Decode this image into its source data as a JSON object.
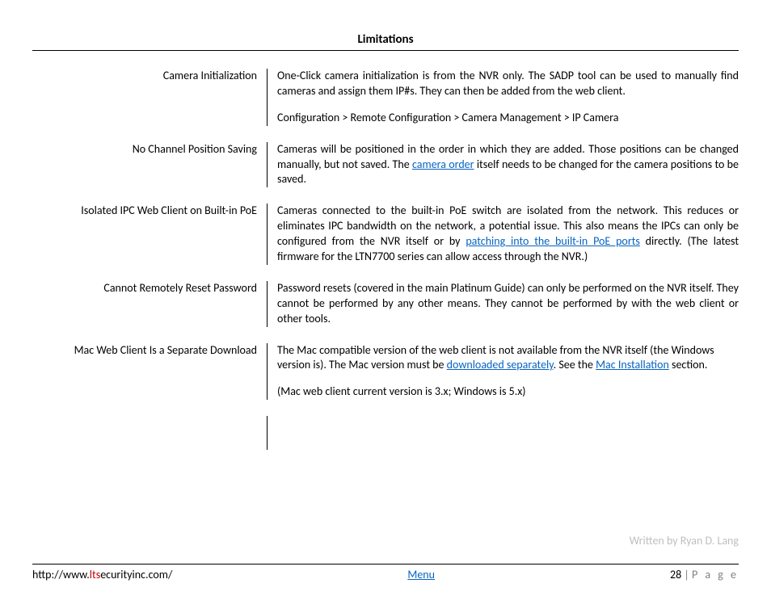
{
  "heading": "Limitations",
  "rows": [
    {
      "label": "Camera Initialization",
      "paragraphs": [
        {
          "justify": true,
          "segments": [
            {
              "t": "One-Click camera initialization is from the NVR only.  The SADP tool can be used to manually find cameras and assign them IP#s.  They can then be added from the web client."
            }
          ]
        },
        {
          "justify": false,
          "segments": [
            {
              "t": "Configuration > Remote Configuration > Camera Management > IP Camera"
            }
          ]
        }
      ]
    },
    {
      "label": "No Channel Position Saving",
      "paragraphs": [
        {
          "justify": true,
          "segments": [
            {
              "t": "Cameras will be positioned in the order in which they are added.  Those positions can be changed manually, but not saved.  The "
            },
            {
              "t": "camera order",
              "link": true
            },
            {
              "t": " itself needs to be changed for the camera positions to be saved."
            }
          ]
        }
      ]
    },
    {
      "label": "Isolated IPC Web Client on Built-in PoE",
      "paragraphs": [
        {
          "justify": true,
          "segments": [
            {
              "t": "Cameras connected to the built-in PoE switch are isolated from the network.  This reduces or eliminates IPC bandwidth on the network, a potential issue.  This also means the IPCs can only be configured from the NVR itself or by "
            },
            {
              "t": "patching into the built-in PoE ports",
              "link": true
            },
            {
              "t": " directly. (The latest firmware for the LTN7700 series can allow access through the NVR.)"
            }
          ]
        }
      ]
    },
    {
      "label": "Cannot Remotely Reset Password",
      "paragraphs": [
        {
          "justify": true,
          "segments": [
            {
              "t": "Password resets (covered in the main Platinum Guide) can only be performed on the NVR itself.  They cannot be performed by any other means.  They cannot be performed by with the web client or other tools."
            }
          ]
        }
      ]
    },
    {
      "label": "Mac Web Client Is a Separate Download",
      "paragraphs": [
        {
          "justify": false,
          "segments": [
            {
              "t": "The Mac compatible version of the web client is not available from the NVR itself (the Windows version is).  The Mac version must be "
            },
            {
              "t": "downloaded separately",
              "link": true
            },
            {
              "t": ".  See the "
            },
            {
              "t": "Mac Installation",
              "link": true
            },
            {
              "t": " section."
            }
          ]
        },
        {
          "justify": false,
          "segments": [
            {
              "t": "(Mac web client current version is 3.x; Windows is 5.x)"
            }
          ]
        }
      ]
    }
  ],
  "attribution": "Written by Ryan D. Lang",
  "footer": {
    "url_pre": "http://www.",
    "url_brand": "lts",
    "url_post": "ecurityinc.com/",
    "menu": "Menu",
    "page_number": "28",
    "page_word": "P a g e"
  }
}
